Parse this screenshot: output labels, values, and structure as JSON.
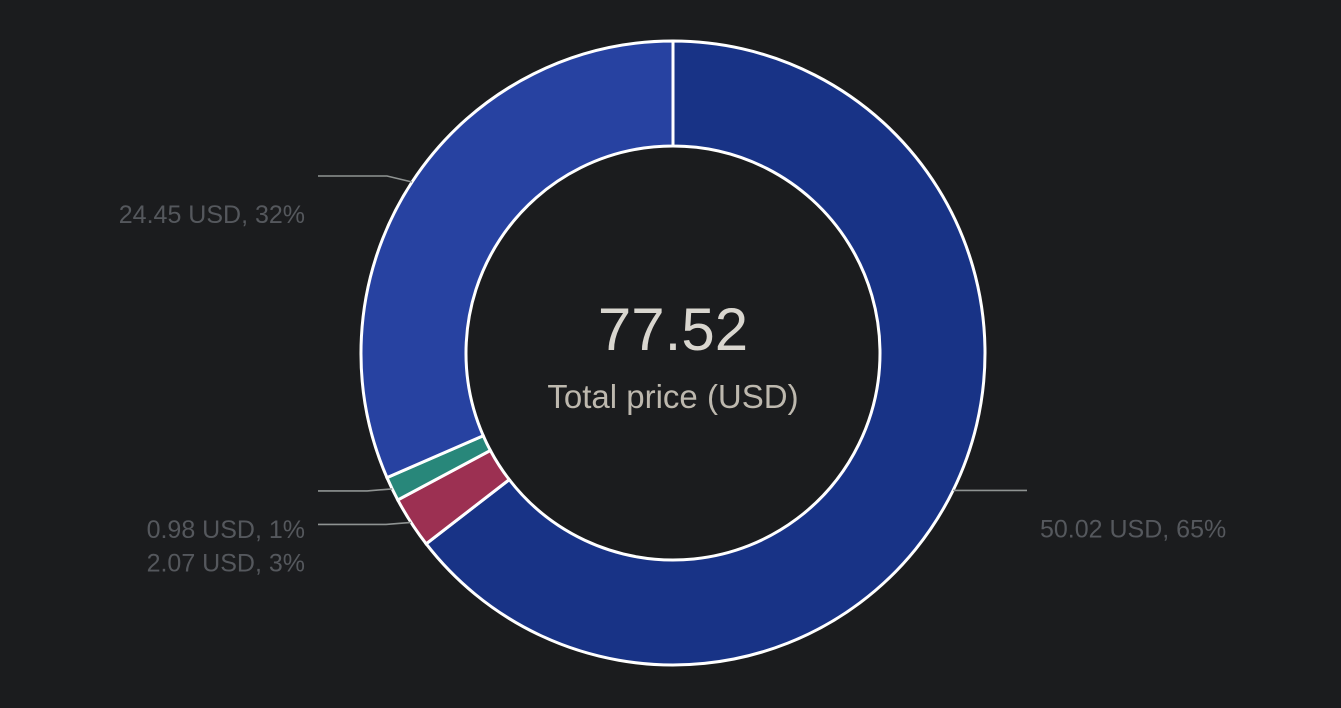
{
  "chart_data": {
    "type": "pie",
    "variant": "donut",
    "center": {
      "value": "77.52",
      "caption": "Total price (USD)"
    },
    "unit": "USD",
    "slices": [
      {
        "name": "",
        "value": 50.02,
        "value_label": "50.02 USD, 65%",
        "color": "#183386",
        "label_side": "right"
      },
      {
        "name": "",
        "value": 2.07,
        "value_label": "2.07 USD, 3%",
        "color": "#9c3052",
        "label_side": "left"
      },
      {
        "name": "",
        "value": 0.98,
        "value_label": "0.98 USD, 1%",
        "color": "#28877a",
        "label_side": "left"
      },
      {
        "name": "",
        "value": 24.45,
        "value_label": "24.45 USD, 32%",
        "color": "#2742a1",
        "label_side": "left"
      }
    ],
    "start_angle_deg": 0,
    "direction": "clockwise",
    "legend": "none",
    "colors": {
      "background": "#1b1c1e",
      "slice_border": "#ffffff",
      "label_text": "#55585d",
      "leader_line": "#8f9392"
    }
  }
}
